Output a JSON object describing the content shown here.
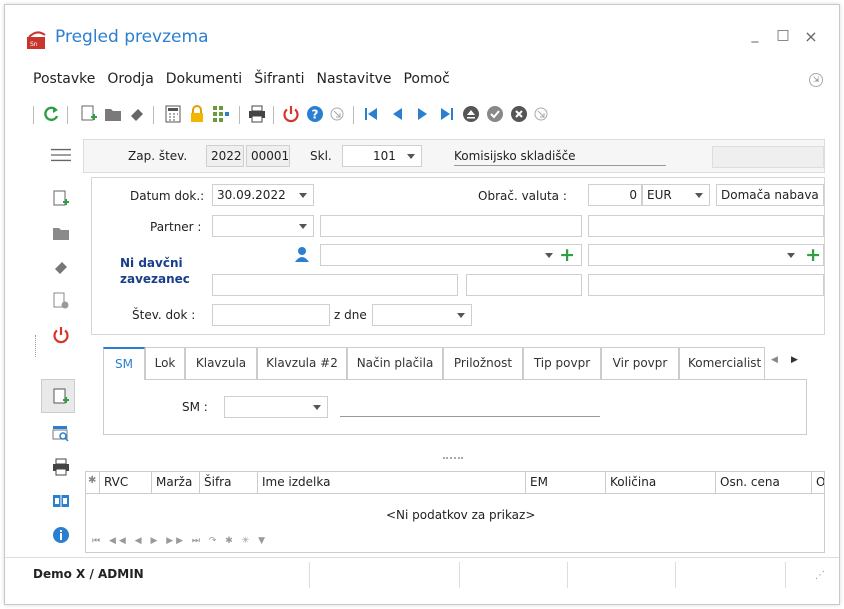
{
  "window": {
    "title": "Pregled prevzema",
    "minimize": "_",
    "maximize": "□",
    "close": "×"
  },
  "menu": [
    "Postavke",
    "Orodja",
    "Dokumenti",
    "Šifranti",
    "Nastavitve",
    "Pomoč"
  ],
  "header": {
    "zap_label": "Zap. štev.",
    "zap_year": "2022",
    "zap_num": "00001",
    "skl_label": "Skl.",
    "skl_value": "101",
    "skl_name": "Komisijsko skladišče"
  },
  "form": {
    "datum_label": "Datum dok.:",
    "datum_value": "30.09.2022",
    "valuta_label": "Obrač. valuta :",
    "valuta_rate": "0",
    "valuta_code": "EUR",
    "nabava_value": "Domača nabava",
    "partner_label": "Partner :",
    "ni_davcni_line1": "Ni davčni",
    "ni_davcni_line2": "zavezanec",
    "stev_dok_label": "Štev. dok :",
    "z_dne_label": "z dne"
  },
  "tabs": [
    "SM",
    "Lok",
    "Klavzula",
    "Klavzula #2",
    "Način plačila",
    "Priložnost",
    "Tip povpr",
    "Vir povpr",
    "Komercialist"
  ],
  "tab_panel": {
    "sm_label": "SM :"
  },
  "grid": {
    "columns": [
      "RVC",
      "Marža",
      "Šifra",
      "Ime izdelka",
      "EM",
      "Količina",
      "Osn. cena",
      "O"
    ],
    "empty_text": "<Ni podatkov za prikaz>"
  },
  "status": {
    "user": "Demo X / ADMIN"
  },
  "colors": {
    "accent": "#2b7fd0",
    "green": "#2ea043",
    "red": "#d9342b"
  }
}
